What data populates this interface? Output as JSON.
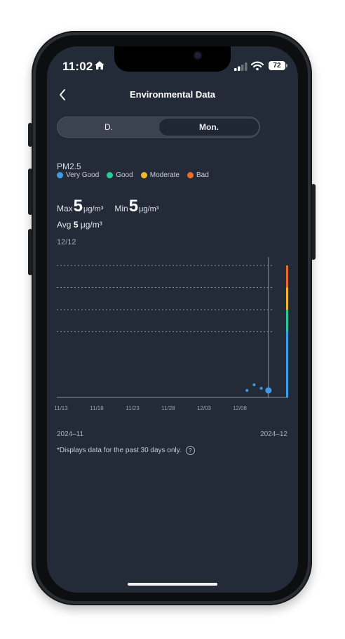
{
  "status_bar": {
    "time": "11:02",
    "home_icon": "house-icon",
    "signal_icon": "cellular-signal-icon",
    "wifi_icon": "wifi-icon",
    "battery_level": "72"
  },
  "header": {
    "title": "Environmental Data",
    "back_icon": "chevron-left-icon"
  },
  "tabs": [
    {
      "label": "D.",
      "selected": false
    },
    {
      "label": "Mon.",
      "selected": true
    }
  ],
  "metric": {
    "name": "PM2.5",
    "legend": [
      {
        "label": "Very Good",
        "color": "#3e9be8"
      },
      {
        "label": "Good",
        "color": "#2ec79a"
      },
      {
        "label": "Moderate",
        "color": "#f2b826"
      },
      {
        "label": "Bad",
        "color": "#ec6a2c"
      }
    ]
  },
  "stats": {
    "max_label": "Max",
    "max_value": "5",
    "min_label": "Min",
    "min_value": "5",
    "unit": "μg/m³",
    "avg_label": "Avg",
    "avg_value": "5",
    "avg_unit": "μg/m³"
  },
  "selected_date": "12/12",
  "range": {
    "start": "2024–11",
    "end": "2024–12"
  },
  "footnote": "*Displays data for the past 30 days only.",
  "help_icon": "question-mark-icon",
  "chart_data": {
    "type": "scatter",
    "x_ticks": [
      "11/13",
      "11/18",
      "11/23",
      "11/28",
      "12/03",
      "12/08"
    ],
    "points": [
      {
        "x": "12/09",
        "y": 5
      },
      {
        "x": "12/10",
        "y": 5
      },
      {
        "x": "12/11",
        "y": 5
      },
      {
        "x": "12/12",
        "y": 5
      }
    ],
    "grid": true,
    "grid_lines": 4,
    "grid_style": "dotted",
    "selected_x": "12/12",
    "colors": {
      "point": "#3e9be8",
      "cursor": "#8a929d",
      "axis": "#8a929d"
    }
  }
}
